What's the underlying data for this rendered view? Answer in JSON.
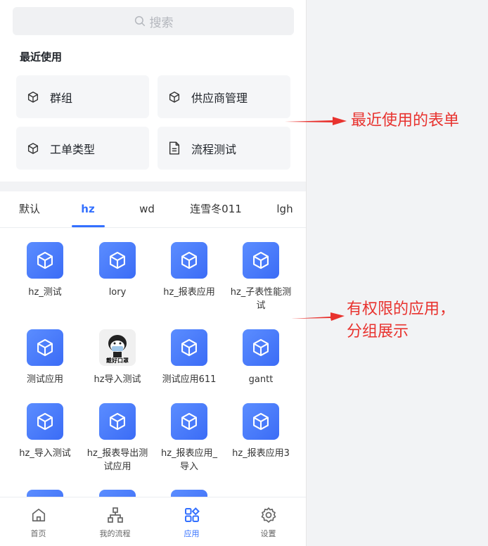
{
  "search": {
    "placeholder": "搜索"
  },
  "recent": {
    "title": "最近使用",
    "items": [
      {
        "label": "群组",
        "icon": "cube-icon"
      },
      {
        "label": "供应商管理",
        "icon": "cube-icon"
      },
      {
        "label": "工单类型",
        "icon": "cube-icon"
      },
      {
        "label": "流程测试",
        "icon": "document-icon"
      }
    ]
  },
  "tabs": [
    "默认",
    "hz",
    "wd",
    "连雪冬011",
    "lgh"
  ],
  "active_tab": "hz",
  "apps": [
    {
      "label": "hz_测试"
    },
    {
      "label": "lory"
    },
    {
      "label": "hz_报表应用"
    },
    {
      "label": "hz_子表性能测试"
    },
    {
      "label": "测试应用"
    },
    {
      "label": "hz导入测试",
      "image_caption": "戴好口罩"
    },
    {
      "label": "测试应用611"
    },
    {
      "label": "gantt"
    },
    {
      "label": "hz_导入测试"
    },
    {
      "label": "hz_报表导出测试应用"
    },
    {
      "label": "hz_报表应用_导入"
    },
    {
      "label": "hz_报表应用3"
    }
  ],
  "bottom_nav": [
    {
      "label": "首页",
      "icon": "home-icon"
    },
    {
      "label": "我的流程",
      "icon": "flow-icon"
    },
    {
      "label": "应用",
      "icon": "apps-icon"
    },
    {
      "label": "设置",
      "icon": "gear-icon"
    }
  ],
  "annotations": {
    "recent": "最近使用的表单",
    "apps_line1": "有权限的应用，",
    "apps_line2": "分组展示"
  },
  "colors": {
    "accent": "#3370ff",
    "annotation": "#e8322e"
  }
}
